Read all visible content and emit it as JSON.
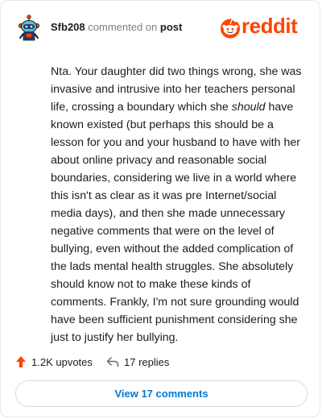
{
  "header": {
    "username": "Sfb208",
    "action_text": "commented on",
    "post_link": "post",
    "brand": "reddit"
  },
  "comment": {
    "text_before_em": "Nta. Your daughter did two things wrong, she was invasive and intrusive into her teachers personal life, crossing a boundary which she ",
    "text_em": "should",
    "text_after_em": " have known existed (but perhaps this should be a lesson for you and your husband to have with her about online privacy and reasonable social boundaries, considering we live in a world where this isn't as clear as it was pre Internet/social media days), and then she made unnecessary negative comments that were on the level of bullying, even without the added complication of the lads mental health struggles. She absolutely should know not to make these kinds of comments. Frankly, I'm not sure grounding would have been sufficient punishment considering she just to justify her bullying."
  },
  "actions": {
    "upvotes": "1.2K upvotes",
    "replies": "17 replies"
  },
  "footer": {
    "view_comments": "View 17 comments"
  },
  "colors": {
    "brand": "#ff4500",
    "link": "#0079d3",
    "text": "#1c1c1c",
    "muted": "#7c8186"
  },
  "icons": {
    "avatar": "snoo-avatar",
    "logo": "reddit-snoo-icon",
    "upvote": "upvote-arrow-icon",
    "reply": "reply-arrow-icon"
  }
}
